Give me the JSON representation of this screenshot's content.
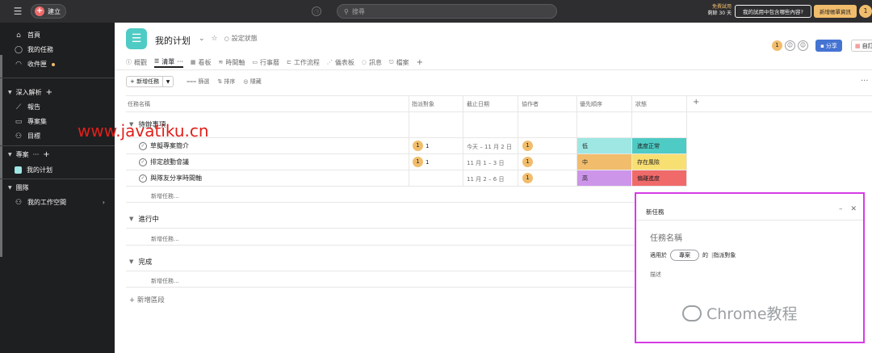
{
  "topbar": {
    "create_label": "建立",
    "search_placeholder": "搜尋",
    "trial_label": "免費試用",
    "trial_days": "剩餘 30 天",
    "trial_question": "我的試用中包含哪些內容?",
    "add_billing": "新增帳單資訊",
    "avatar": "1"
  },
  "sidebar": {
    "nav": [
      {
        "label": "首頁",
        "icon": "home-icon"
      },
      {
        "label": "我的任務",
        "icon": "check-circle-icon"
      },
      {
        "label": "收件匣",
        "icon": "bell-icon"
      }
    ],
    "insights": {
      "label": "深入解析",
      "items": [
        {
          "label": "報告",
          "icon": "chart-line-icon"
        },
        {
          "label": "專案集",
          "icon": "folder-icon"
        },
        {
          "label": "目標",
          "icon": "person-icon"
        }
      ]
    },
    "projects": {
      "label": "專案",
      "items": [
        {
          "label": "我的计划"
        }
      ]
    },
    "team": {
      "label": "團隊",
      "items": [
        {
          "label": "我的工作空間"
        }
      ]
    }
  },
  "header": {
    "title": "我的计划",
    "status": "設定狀態",
    "share": "分享",
    "customize": "自訂",
    "avatars": [
      "1"
    ]
  },
  "tabs": [
    {
      "label": "概觀",
      "icon": "ⓘ"
    },
    {
      "label": "清單",
      "icon": "☰"
    },
    {
      "label": "看板",
      "icon": "▦"
    },
    {
      "label": "時間軸",
      "icon": "≋"
    },
    {
      "label": "行事曆",
      "icon": "▭"
    },
    {
      "label": "工作流程",
      "icon": "⊏"
    },
    {
      "label": "儀表板",
      "icon": "⋰"
    },
    {
      "label": "訊息",
      "icon": "◌"
    },
    {
      "label": "檔案",
      "icon": "⎋"
    }
  ],
  "toolbar": {
    "add_task": "+ 新增任務",
    "filter": "篩選",
    "sort": "排序",
    "hide": "隱藏"
  },
  "columns": {
    "name": "任務名稱",
    "assignee": "指派對象",
    "due": "截止日期",
    "collaborators": "協作者",
    "priority": "優先順序",
    "status": "狀態"
  },
  "groups": {
    "todo": "待辦事項",
    "doing": "進行中",
    "done": "完成",
    "add_task": "新增任務...",
    "add_section": "+ 新增區段"
  },
  "tasks": [
    {
      "name": "草擬專案簡介",
      "assignee_count": "1",
      "avatar": "1",
      "due": "今天 – 11 月 2 日",
      "collab": "1",
      "priority": "低",
      "priority_color": "#9ee7e3",
      "status": "進度正常",
      "status_color": "#4ecbc4"
    },
    {
      "name": "排定啟動會議",
      "assignee_count": "1",
      "avatar": "1",
      "due": "11 月 1 – 3 日",
      "collab": "1",
      "priority": "中",
      "priority_color": "#f1bd6c",
      "status": "存在風險",
      "status_color": "#f8df72"
    },
    {
      "name": "與隊友分享時間軸",
      "assignee_count": "",
      "avatar": "",
      "due": "11 月 2 – 6 日",
      "collab": "1",
      "priority": "高",
      "priority_color": "#cd95ea",
      "status": "偏離進度",
      "status_color": "#f06a6a"
    }
  ],
  "watermark": "www.javatiku.cn",
  "new_task_panel": {
    "title": "新任務",
    "name_placeholder": "任務名稱",
    "for_label": "適用於",
    "project_chip": "專案",
    "of": "的",
    "assignee": "指派對象",
    "description": "描述",
    "watermark": "Chrome教程"
  }
}
